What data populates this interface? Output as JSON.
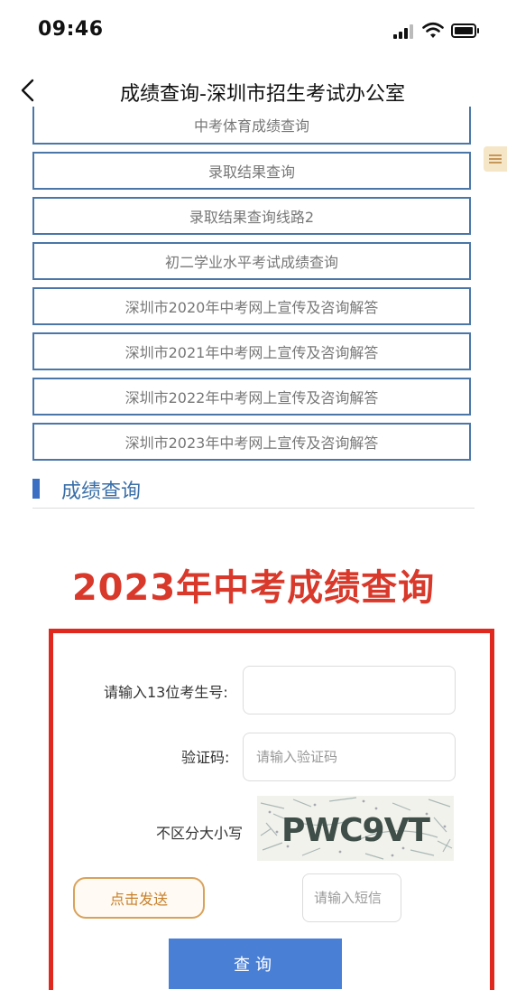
{
  "status_bar": {
    "time": "09:46"
  },
  "nav": {
    "title": "成绩查询-深圳市招生考试办公室"
  },
  "links": [
    "中考体育成绩查询",
    "录取结果查询",
    "录取结果查询线路2",
    "初二学业水平考试成绩查询",
    "深圳市2020年中考网上宣传及咨询解答",
    "深圳市2021年中考网上宣传及咨询解答",
    "深圳市2022年中考网上宣传及咨询解答",
    "深圳市2023年中考网上宣传及咨询解答"
  ],
  "section": {
    "title": "成绩查询"
  },
  "headline": "2023年中考成绩查询",
  "form": {
    "exam_no_label": "请输入13位考生号:",
    "exam_no_value": "",
    "captcha_label": "验证码:",
    "captcha_placeholder": "请输入验证码",
    "case_note": "不区分大小写",
    "captcha_text": "PWC9VT",
    "send_label": "点击发送",
    "sms_placeholder": "请输入短信",
    "query_label": "查询"
  },
  "colors": {
    "accent_blue": "#4a7fd6",
    "headline_red": "#d8392b",
    "frame_red": "#e0281e",
    "send_orange": "#d9a25b"
  }
}
